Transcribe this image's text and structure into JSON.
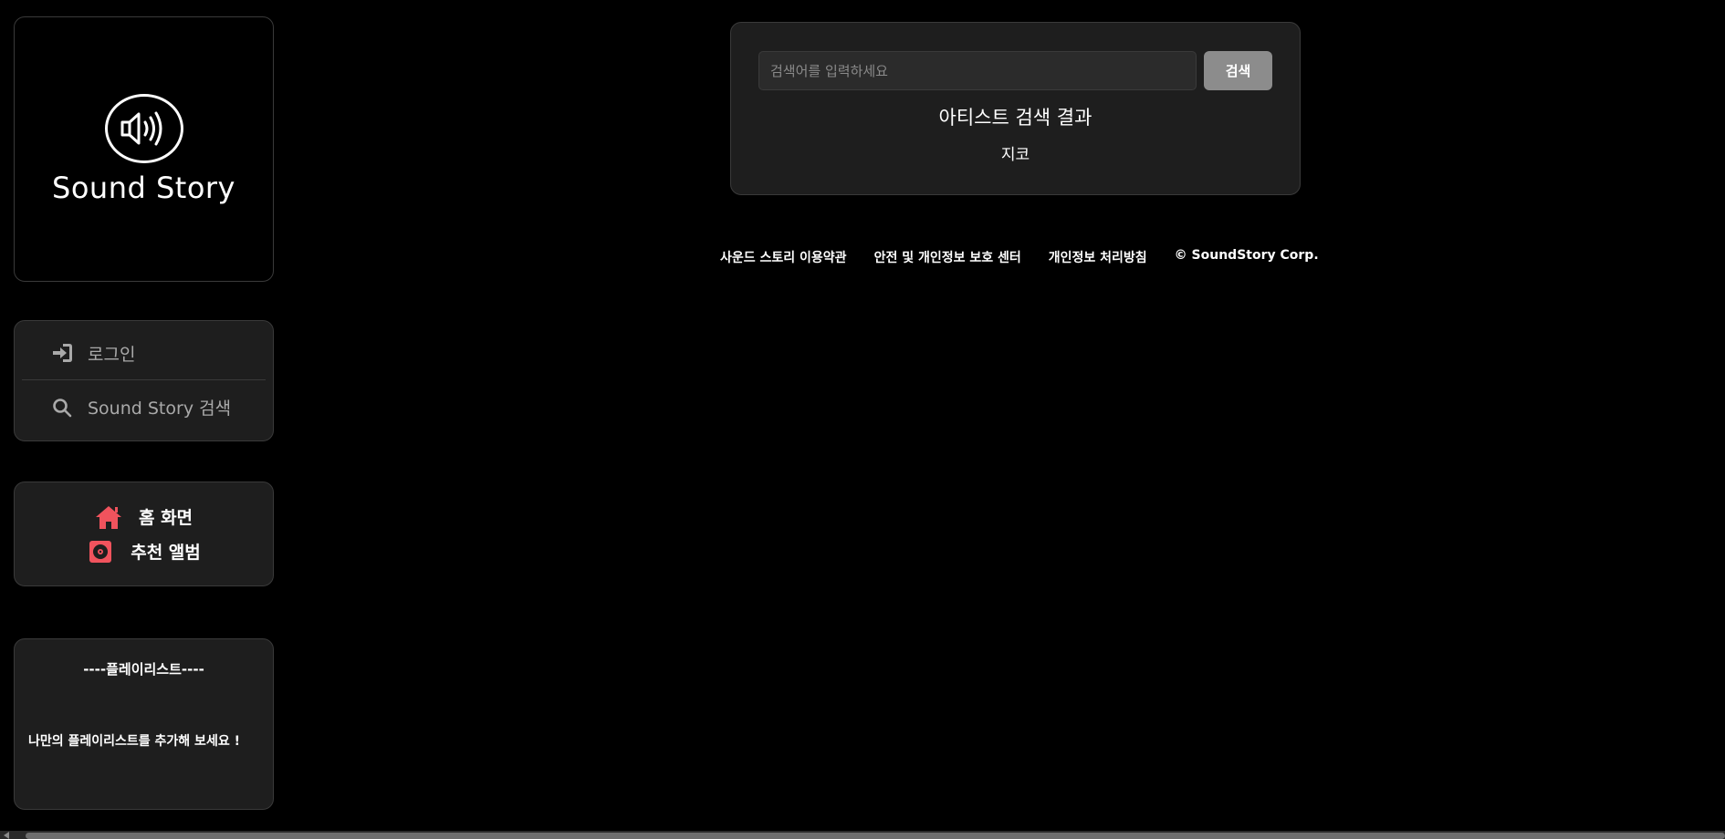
{
  "brand": {
    "name": "Sound Story",
    "logo_icon": "speaker-icon"
  },
  "menu": {
    "login_label": "로그인",
    "login_icon": "sign-in-icon",
    "search_label": "Sound Story 검색",
    "search_icon": "search-icon"
  },
  "nav": {
    "home_label": "홈 화면",
    "home_icon": "home-icon",
    "albums_label": "추천 앨범",
    "albums_icon": "vinyl-record-icon",
    "icon_color": "#f0535d"
  },
  "playlist": {
    "title": "----플레이리스트----",
    "empty_message": "나만의 플레이리스트를 추가해 보세요 !"
  },
  "search": {
    "placeholder": "검색어를 입력하세요",
    "value": "",
    "button_label": "검색",
    "results_title": "아티스트 검색 결과",
    "results": [
      "지코"
    ]
  },
  "footer": {
    "links": [
      "사운드 스토리 이용약관",
      "안전 및 개인정보 보호 센터",
      "개인정보 처리방침"
    ],
    "copyright": "© SoundStory Corp."
  }
}
